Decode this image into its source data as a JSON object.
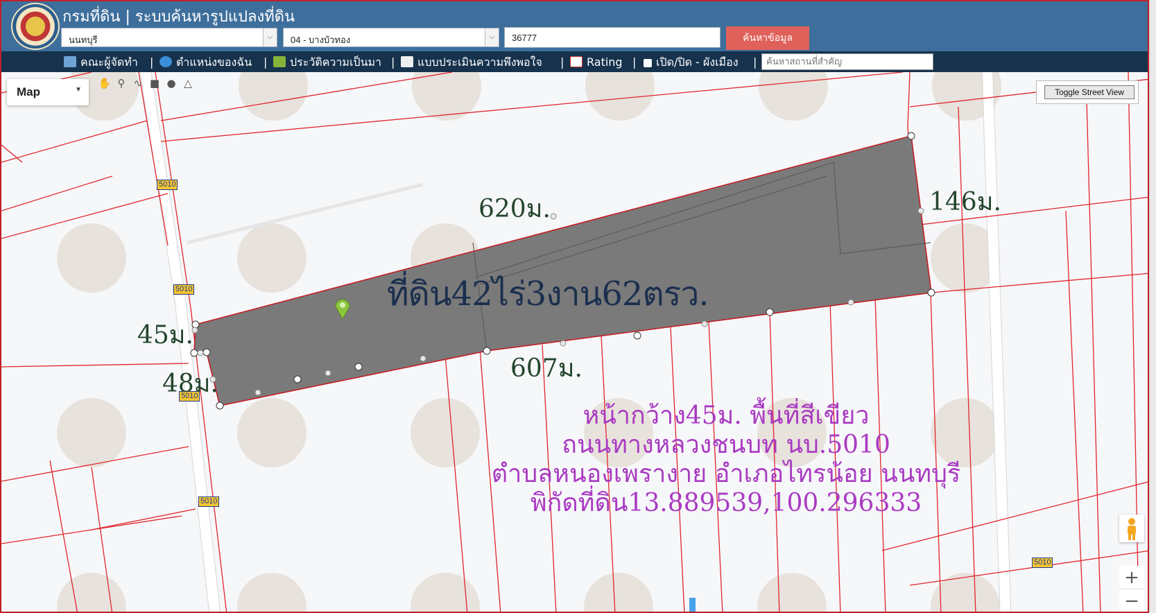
{
  "header": {
    "title": "กรมที่ดิน | ระบบค้นหารูปแปลงที่ดิน",
    "province": "นนทบุรี",
    "district": "04 - บางบัวทอง",
    "parcel_number": "36777",
    "search_button": "ค้นหาข้อมูล"
  },
  "nav": {
    "items": [
      {
        "label": "คณะผู้จัดทำ"
      },
      {
        "label": "ตำแหน่งของฉัน"
      },
      {
        "label": "ประวัติความเป็นมา"
      },
      {
        "label": "แบบประเมินความพึงพอใจ"
      },
      {
        "label": "Rating"
      },
      {
        "label": "เปิด/ปิด - ผังเมือง"
      }
    ],
    "separator": "|",
    "search_placeholder": "ค้นหาสถานที่สำคัญ"
  },
  "map": {
    "map_type": "Map",
    "street_view_button": "Toggle Street View",
    "zoom_in": "+",
    "zoom_out": "−",
    "road_shields": [
      "5010",
      "5010",
      "5010",
      "5010",
      "5010"
    ],
    "edge_labels": {
      "top": "620ม.",
      "right": "146ม.",
      "left": "45ม.",
      "bottom_left": "48ม.",
      "bottom": "607ม."
    },
    "area_label": "ที่ดิน42ไร่3งาน62ตรว.",
    "info_lines": [
      "หน้ากว้าง45ม. พื้นที่สีเขียว",
      "ถนนทางหลวงชนบท นบ.5010",
      "ตำบลหนองเพรางาย อำเภอไทรน้อย นนทบุรี",
      "พิกัดที่ดิน13.889539,100.296333"
    ],
    "colors": {
      "parcel_fill": "#7a7a7a",
      "boundary": "#e0252c",
      "header": "#3e6f9c",
      "nav": "#16324d",
      "search_button": "#e0615a"
    }
  }
}
